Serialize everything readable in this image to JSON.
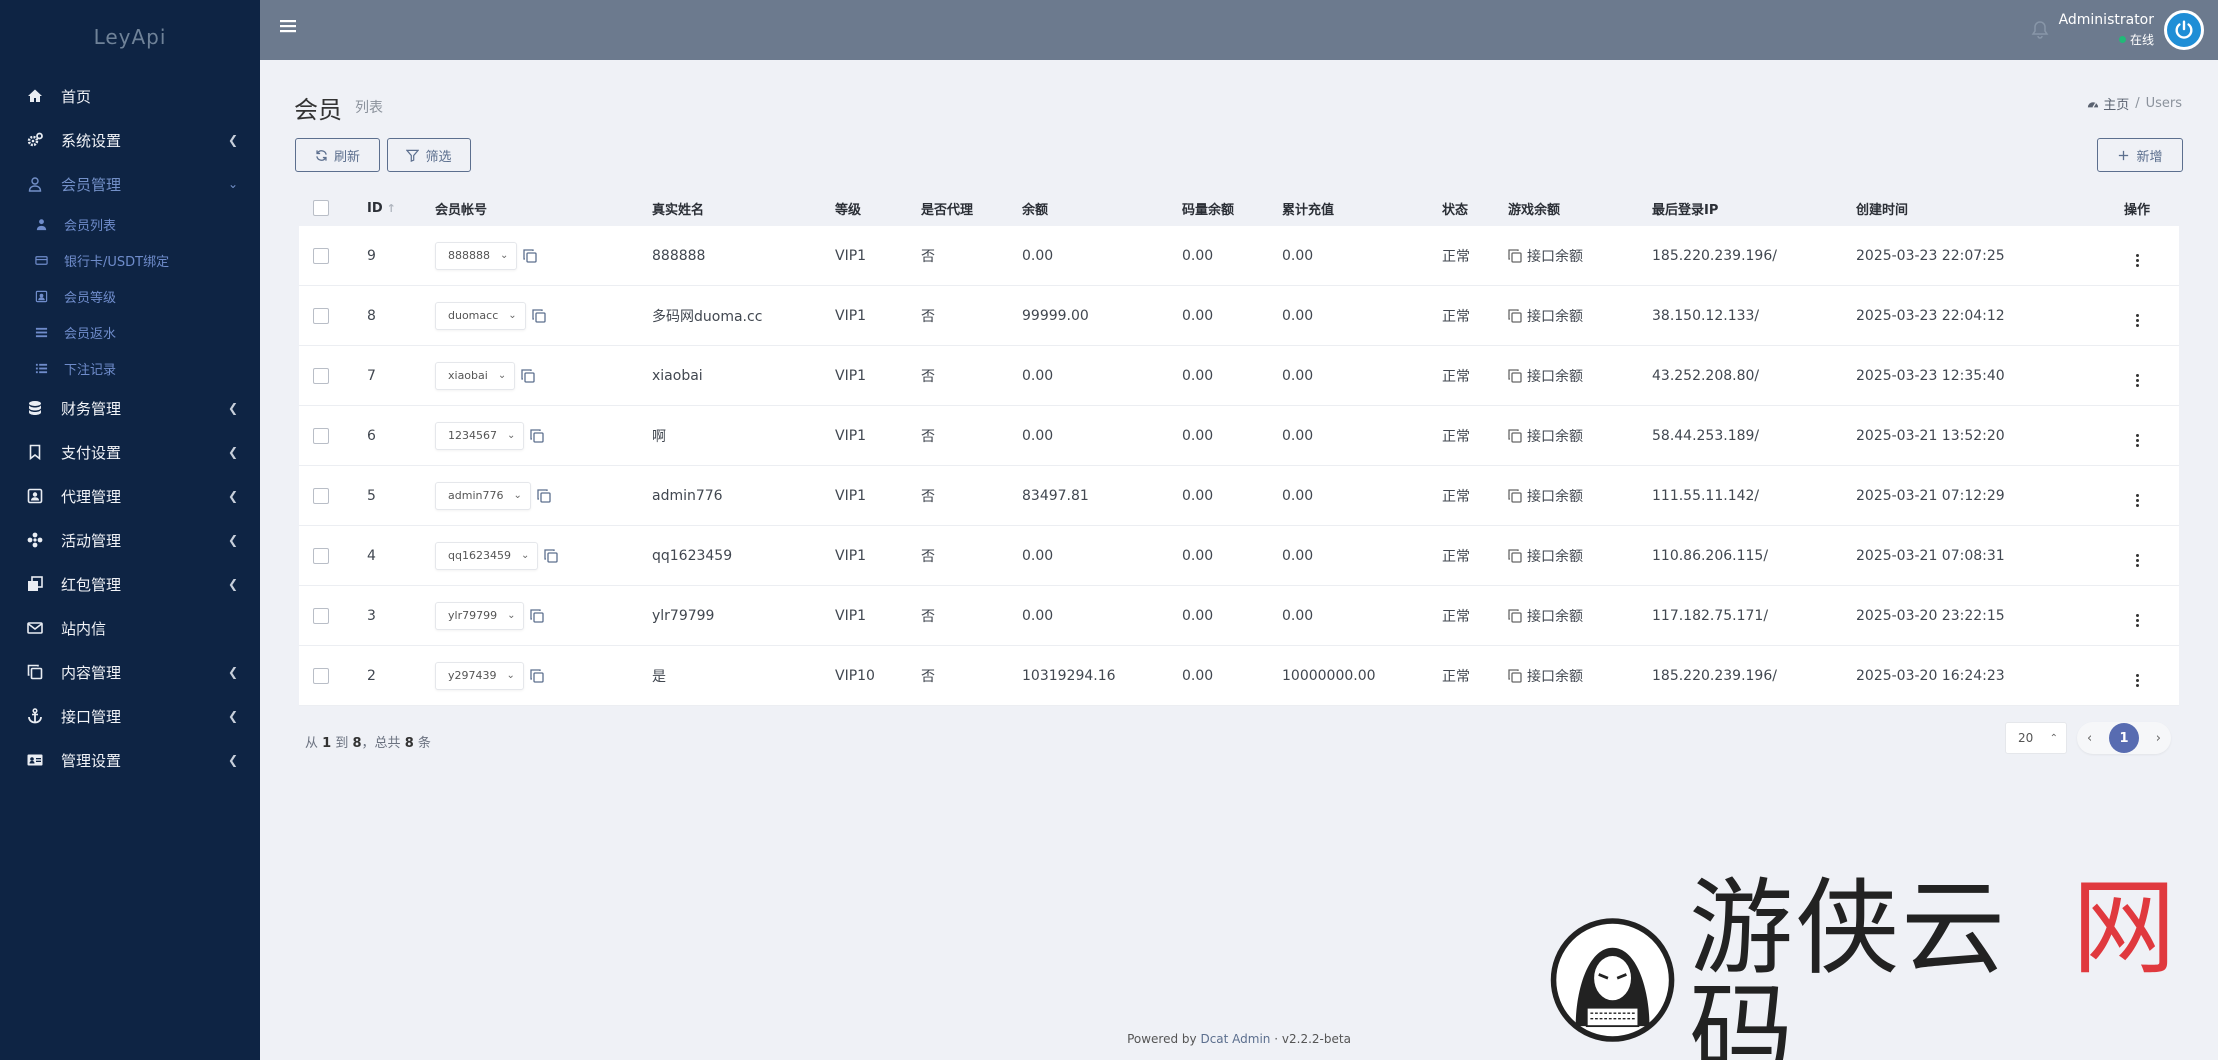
{
  "brand": "LeyApi",
  "sidebar": {
    "items": [
      {
        "label": "首页",
        "icon": "home-icon",
        "chevron": false
      },
      {
        "label": "系统设置",
        "icon": "gears-icon",
        "chevron": true
      },
      {
        "label": "会员管理",
        "icon": "user-icon",
        "chevron": true,
        "expanded": true
      },
      {
        "label": "财务管理",
        "icon": "database-icon",
        "chevron": true
      },
      {
        "label": "支付设置",
        "icon": "bookmark-icon",
        "chevron": true
      },
      {
        "label": "代理管理",
        "icon": "id-card-icon",
        "chevron": true
      },
      {
        "label": "活动管理",
        "icon": "pinwheel-icon",
        "chevron": true
      },
      {
        "label": "红包管理",
        "icon": "clone-icon",
        "chevron": true
      },
      {
        "label": "站内信",
        "icon": "envelope-icon",
        "chevron": false
      },
      {
        "label": "内容管理",
        "icon": "copy-icon",
        "chevron": true
      },
      {
        "label": "接口管理",
        "icon": "anchor-icon",
        "chevron": true
      },
      {
        "label": "管理设置",
        "icon": "address-card-icon",
        "chevron": true
      }
    ],
    "member_sub": [
      {
        "label": "会员列表",
        "icon": "user-small-icon"
      },
      {
        "label": "银行卡/USDT绑定",
        "icon": "credit-card-icon"
      },
      {
        "label": "会员等级",
        "icon": "badge-icon"
      },
      {
        "label": "会员返水",
        "icon": "list-icon"
      },
      {
        "label": "下注记录",
        "icon": "list-ol-icon"
      }
    ]
  },
  "header": {
    "user_name": "Administrator",
    "user_status": "在线"
  },
  "page": {
    "title": "会员",
    "subtitle": "列表",
    "breadcrumb_home": "主页",
    "breadcrumb_sep": "/",
    "breadcrumb_current": "Users"
  },
  "toolbar": {
    "refresh_label": "刷新",
    "filter_label": "筛选",
    "add_label": "新增"
  },
  "table": {
    "columns": [
      "ID",
      "会员帐号",
      "真实姓名",
      "等级",
      "是否代理",
      "余额",
      "码量余额",
      "累计充值",
      "状态",
      "游戏余额",
      "最后登录IP",
      "创建时间",
      "操作"
    ],
    "game_balance_label": "接口余额",
    "rows": [
      {
        "id": "9",
        "account": "888888",
        "name": "888888",
        "level": "VIP1",
        "agent": "否",
        "balance": "0.00",
        "code_balance": "0.00",
        "recharge": "0.00",
        "status": "正常",
        "ip": "185.220.239.196/",
        "created": "2025-03-23 22:07:25"
      },
      {
        "id": "8",
        "account": "duomacc",
        "name": "多码网duoma.cc",
        "level": "VIP1",
        "agent": "否",
        "balance": "99999.00",
        "code_balance": "0.00",
        "recharge": "0.00",
        "status": "正常",
        "ip": "38.150.12.133/",
        "created": "2025-03-23 22:04:12"
      },
      {
        "id": "7",
        "account": "xiaobai",
        "name": "xiaobai",
        "level": "VIP1",
        "agent": "否",
        "balance": "0.00",
        "code_balance": "0.00",
        "recharge": "0.00",
        "status": "正常",
        "ip": "43.252.208.80/",
        "created": "2025-03-23 12:35:40"
      },
      {
        "id": "6",
        "account": "1234567",
        "name": "啊",
        "level": "VIP1",
        "agent": "否",
        "balance": "0.00",
        "code_balance": "0.00",
        "recharge": "0.00",
        "status": "正常",
        "ip": "58.44.253.189/",
        "created": "2025-03-21 13:52:20"
      },
      {
        "id": "5",
        "account": "admin776",
        "name": "admin776",
        "level": "VIP1",
        "agent": "否",
        "balance": "83497.81",
        "code_balance": "0.00",
        "recharge": "0.00",
        "status": "正常",
        "ip": "111.55.11.142/",
        "created": "2025-03-21 07:12:29"
      },
      {
        "id": "4",
        "account": "qq1623459",
        "name": "qq1623459",
        "level": "VIP1",
        "agent": "否",
        "balance": "0.00",
        "code_balance": "0.00",
        "recharge": "0.00",
        "status": "正常",
        "ip": "110.86.206.115/",
        "created": "2025-03-21 07:08:31"
      },
      {
        "id": "3",
        "account": "ylr79799",
        "name": "ylr79799",
        "level": "VIP1",
        "agent": "否",
        "balance": "0.00",
        "code_balance": "0.00",
        "recharge": "0.00",
        "status": "正常",
        "ip": "117.182.75.171/",
        "created": "2025-03-20 23:22:15"
      },
      {
        "id": "2",
        "account": "y297439",
        "name": "是",
        "level": "VIP10",
        "agent": "否",
        "balance": "10319294.16",
        "code_balance": "0.00",
        "recharge": "10000000.00",
        "status": "正常",
        "ip": "185.220.239.196/",
        "created": "2025-03-20 16:24:23"
      }
    ]
  },
  "summary": {
    "prefix": "从",
    "from": "1",
    "to_word": "到",
    "to": "8",
    "total_word": "，总共",
    "total": "8",
    "suffix": "条"
  },
  "pagination": {
    "per_page": "20",
    "current_page": "1"
  },
  "footer": {
    "powered_by": "Powered by",
    "product": "Dcat Admin",
    "dot": "·",
    "version": "v2.2.2-beta"
  },
  "watermark": {
    "text_main": "游侠云码",
    "text_red": "网"
  },
  "colors": {
    "sidebar_bg": "#0e2444",
    "topbar_bg": "#6c7a8e",
    "accent": "#586cb1",
    "online": "#21b978"
  }
}
